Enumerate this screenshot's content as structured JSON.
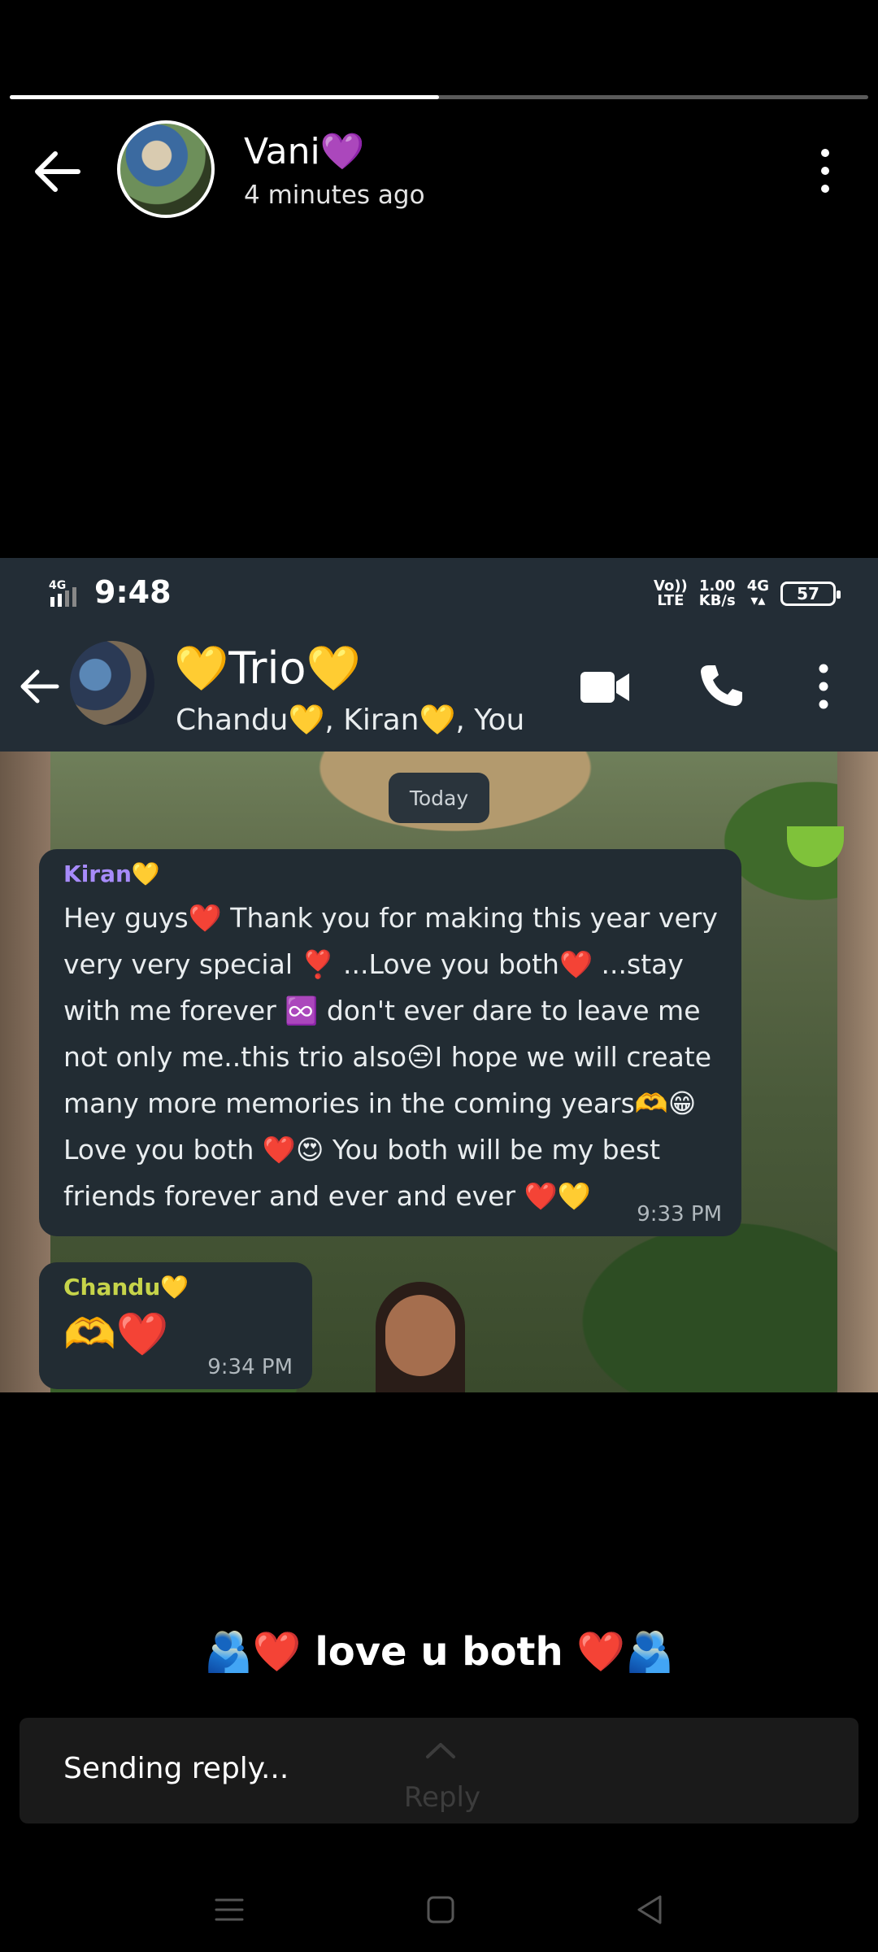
{
  "story": {
    "progress": 0.5,
    "author_name": "Vani💜",
    "posted_time": "4 minutes ago",
    "caption": "🫂❤️ love u both ❤️🫂"
  },
  "screenshot": {
    "status_bar": {
      "time": "9:48",
      "network_left": "4G",
      "volte_top": "Vo))",
      "volte_bottom": "LTE",
      "speed_top": "1.00",
      "speed_bottom": "KB/s",
      "network_right": "4G",
      "battery": "57"
    },
    "chat_header": {
      "group_name": "💛Trio💛",
      "members": "Chandu💛, Kiran💛, You"
    },
    "date_chip": "Today",
    "messages": [
      {
        "sender": "Kiran💛",
        "sender_color": "#a78bfa",
        "text": "Hey guys❤️ Thank you for making this year very very very special ❣️ ...Love you both❤️ ...stay with me forever ♾️ don't ever dare to leave me not only me..this trio also😒I hope we will create many more memories in the coming years🫶😁Love you both ❤️😍 You both will be my best friends forever and ever and ever ❤️💛",
        "time": "9:33 PM"
      },
      {
        "sender": "Chandu💛",
        "sender_color": "#c6d44a",
        "text": "🫶❤️",
        "time": "9:34 PM"
      }
    ]
  },
  "reply": {
    "status": "Sending reply...",
    "label": "Reply"
  },
  "colors": {
    "chat_bg": "#232d36",
    "bubble": "#222c33",
    "progress_track": "#5a5a5a",
    "progress_fill": "#ffffff"
  }
}
